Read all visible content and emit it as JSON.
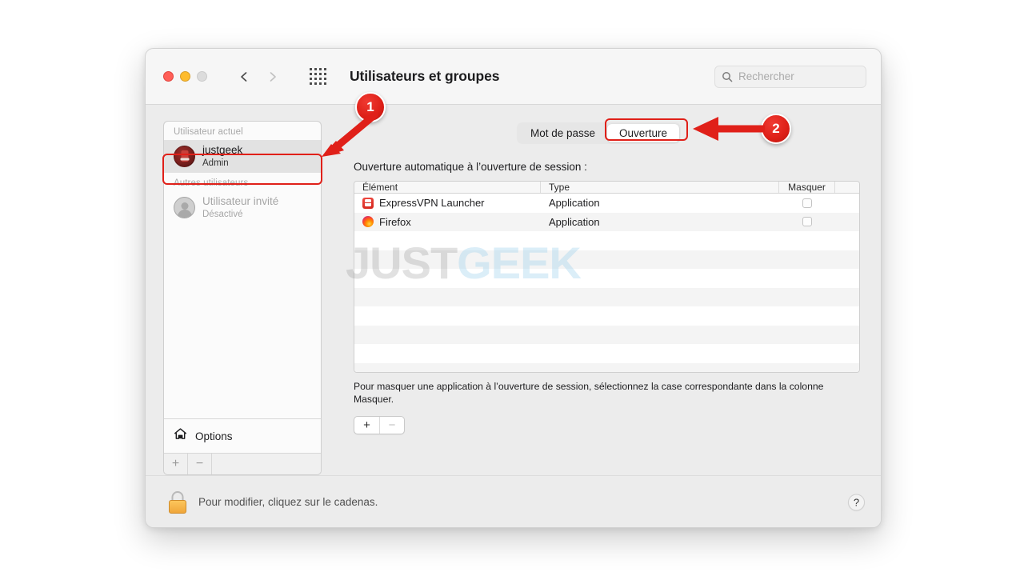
{
  "window": {
    "title": "Utilisateurs et groupes",
    "traffic_lights": [
      "close",
      "minimize",
      "zoom"
    ],
    "nav": {
      "back": "chevron-left",
      "forward": "chevron-right",
      "grid": "grid-view"
    },
    "search": {
      "placeholder": "Rechercher",
      "value": ""
    }
  },
  "sidebar": {
    "groups": [
      {
        "label": "Utilisateur actuel",
        "users": [
          {
            "name": "justgeek",
            "role": "Admin",
            "selected": true,
            "disabled": false
          }
        ]
      },
      {
        "label": "Autres utilisateurs",
        "users": [
          {
            "name": "Utilisateur invité",
            "role": "Désactivé",
            "selected": false,
            "disabled": true
          }
        ]
      }
    ],
    "options_label": "Options",
    "footer": {
      "add": "+",
      "remove": "−"
    }
  },
  "panel": {
    "tabs": [
      {
        "label": "Mot de passe",
        "active": false
      },
      {
        "label": "Ouverture",
        "active": true
      }
    ],
    "section_title": "Ouverture automatique à l’ouverture de session :",
    "table": {
      "columns": [
        "Élément",
        "Type",
        "Masquer"
      ],
      "rows": [
        {
          "element": "ExpressVPN Launcher",
          "type": "Application",
          "hide": false,
          "icon": "expressvpn-icon"
        },
        {
          "element": "Firefox",
          "type": "Application",
          "hide": false,
          "icon": "firefox-icon"
        }
      ],
      "empty_rows": 8
    },
    "hint": "Pour masquer une application à l’ouverture de session, sélectionnez la case correspondante dans la colonne Masquer.",
    "buttons": {
      "add": "+",
      "remove": "−"
    }
  },
  "bottom": {
    "lock_text": "Pour modifier, cliquez sur le cadenas.",
    "help_label": "?"
  },
  "watermark": {
    "part1": "JUST",
    "part2": "GEEK"
  },
  "annotations": [
    {
      "number": "1",
      "target": "sidebar-user-justgeek"
    },
    {
      "number": "2",
      "target": "tab-ouverture"
    }
  ],
  "colors": {
    "accent_red": "#e02019",
    "badge_red": "#dd1f17",
    "lock_gold": "#f5b543",
    "window_bg": "#ececec"
  }
}
